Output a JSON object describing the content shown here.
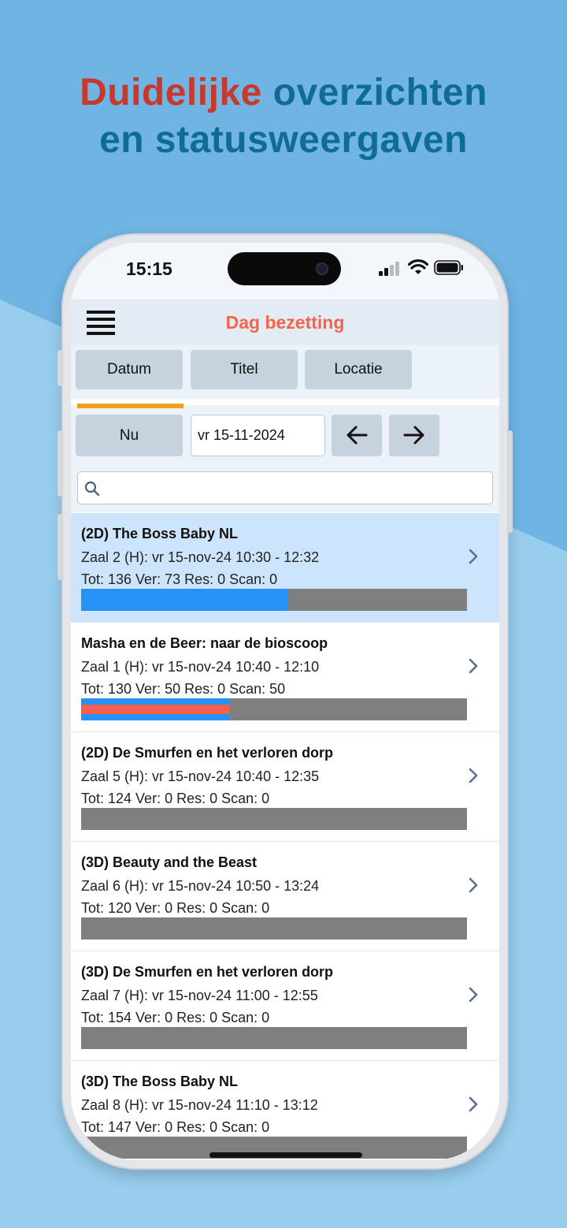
{
  "headline": {
    "part1": "Duidelijke",
    "part2": " overzichten",
    "line2": "en statusweergaven"
  },
  "status_bar": {
    "time": "15:15"
  },
  "app": {
    "title": "Dag bezetting"
  },
  "tabs": [
    {
      "label": "Datum",
      "active": true
    },
    {
      "label": "Titel",
      "active": false
    },
    {
      "label": "Locatie",
      "active": false
    }
  ],
  "date_controls": {
    "now_label": "Nu",
    "date_value": "vr 15-11-2024"
  },
  "search": {
    "placeholder": ""
  },
  "colors": {
    "accent": "#f4634a",
    "tab_indicator": "#f3a01b",
    "sold": "#2791f7",
    "scanned": "#fa5e4d",
    "empty": "#7f7f7f",
    "selected_row": "#cde5fc"
  },
  "screenings": [
    {
      "title": "(2D) The Boss Baby NL",
      "details": "Zaal 2 (H):  vr 15-nov-24 10:30 - 12:32",
      "stats": "Tot: 136 Ver: 73 Res: 0 Scan: 0",
      "total": 136,
      "sold": 73,
      "scan": 0,
      "selected": true
    },
    {
      "title": "Masha en de Beer: naar de bioscoop",
      "details": "Zaal 1 (H):  vr 15-nov-24 10:40 - 12:10",
      "stats": "Tot: 130 Ver: 50 Res: 0 Scan: 50",
      "total": 130,
      "sold": 50,
      "scan": 50,
      "selected": false
    },
    {
      "title": "(2D) De Smurfen en het verloren dorp",
      "details": "Zaal 5 (H):  vr 15-nov-24 10:40 - 12:35",
      "stats": "Tot: 124 Ver: 0 Res: 0 Scan: 0",
      "total": 124,
      "sold": 0,
      "scan": 0,
      "selected": false
    },
    {
      "title": "(3D) Beauty and the Beast",
      "details": "Zaal 6 (H):  vr 15-nov-24 10:50 - 13:24",
      "stats": "Tot: 120 Ver: 0 Res: 0 Scan: 0",
      "total": 120,
      "sold": 0,
      "scan": 0,
      "selected": false
    },
    {
      "title": "(3D) De Smurfen en het verloren dorp",
      "details": "Zaal 7 (H):  vr 15-nov-24 11:00 - 12:55",
      "stats": "Tot: 154 Ver: 0 Res: 0 Scan: 0",
      "total": 154,
      "sold": 0,
      "scan": 0,
      "selected": false
    },
    {
      "title": "(3D) The Boss Baby NL",
      "details": "Zaal 8 (H):  vr 15-nov-24 11:10 - 13:12",
      "stats": "Tot: 147 Ver: 0 Res: 0 Scan: 0",
      "total": 147,
      "sold": 0,
      "scan": 0,
      "selected": false
    }
  ]
}
